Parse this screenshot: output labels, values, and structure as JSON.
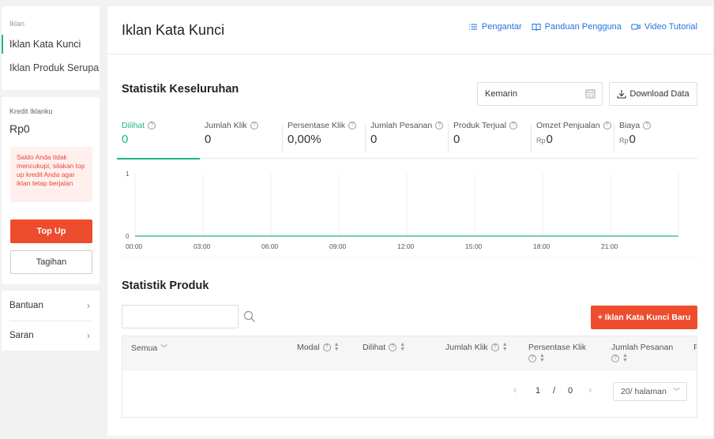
{
  "sidebar": {
    "caption": "Iklan",
    "items": [
      {
        "label": "Iklan Kata Kunci"
      },
      {
        "label": "Iklan Produk Serupa"
      }
    ]
  },
  "credit": {
    "caption": "Kredit Iklanku",
    "amount": "Rp0",
    "warning": "Saldo Anda tidak mencukupi, silakan top up kredit Anda agar iklan tetap berjalan",
    "topup_label": "Top Up",
    "bill_label": "Tagihan"
  },
  "help": {
    "items": [
      {
        "label": "Bantuan"
      },
      {
        "label": "Saran"
      }
    ]
  },
  "header": {
    "title": "Iklan Kata Kunci",
    "links": [
      {
        "label": "Pengantar",
        "icon": "list-icon"
      },
      {
        "label": "Panduan Pengguna",
        "icon": "book-icon"
      },
      {
        "label": "Video Tutorial",
        "icon": "video-icon"
      }
    ]
  },
  "overview": {
    "title": "Statistik Keseluruhan",
    "date_value": "Kemarin",
    "download_label": "Download Data",
    "metrics": [
      {
        "label": "Dilihat",
        "value": "0",
        "currency": ""
      },
      {
        "label": "Jumlah Klik",
        "value": "0",
        "currency": ""
      },
      {
        "label": "Persentase Klik",
        "value": "0,00%",
        "currency": ""
      },
      {
        "label": "Jumlah Pesanan",
        "value": "0",
        "currency": ""
      },
      {
        "label": "Produk Terjual",
        "value": "0",
        "currency": ""
      },
      {
        "label": "Omzet Penjualan",
        "value": "0",
        "currency": "Rp"
      },
      {
        "label": "Biaya",
        "value": "0",
        "currency": "Rp"
      }
    ]
  },
  "chart_data": {
    "type": "line",
    "x": [
      "00:00",
      "03:00",
      "06:00",
      "09:00",
      "12:00",
      "15:00",
      "18:00",
      "21:00"
    ],
    "series": [
      {
        "values": [
          0,
          0,
          0,
          0,
          0,
          0,
          0,
          0
        ]
      }
    ],
    "y_ticks": [
      "0",
      "1"
    ],
    "ylim": [
      0,
      1
    ],
    "grid": true,
    "color": "#1fb58c"
  },
  "product_stats": {
    "title": "Statistik Produk",
    "search_placeholder": "",
    "add_button": "+ Iklan Kata Kunci Baru",
    "columns": [
      "Semua",
      "Modal",
      "Dilihat",
      "Jumlah Klik",
      "Persentase Klik",
      "Jumlah Pesanan",
      "P"
    ],
    "pager": {
      "current": "1",
      "sep": "/",
      "total": "0",
      "per_page": "20/ halaman"
    }
  }
}
